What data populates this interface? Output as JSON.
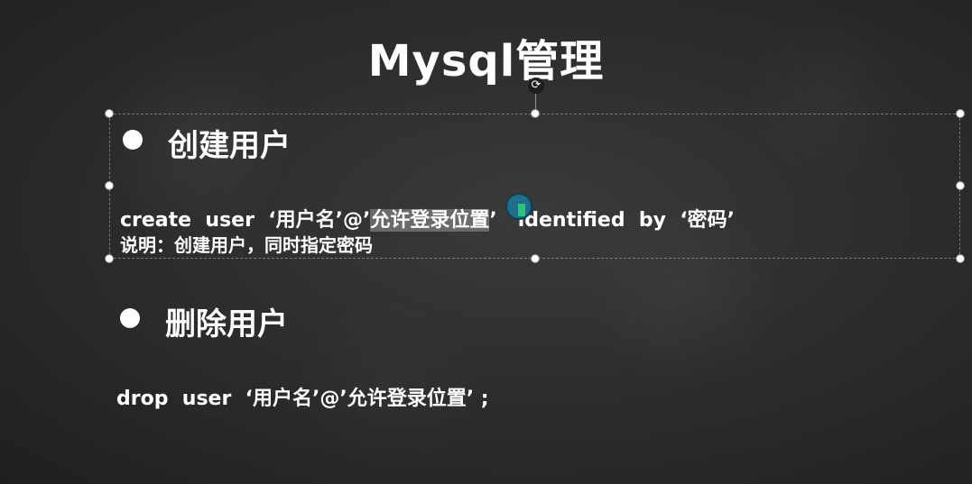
{
  "slide": {
    "title": "Mysql管理",
    "section1": {
      "heading": "创建用户",
      "code_prefix": "create  user  ‘用户名’@’",
      "code_highlight": "允许登录位置",
      "code_suffix": "’   identified  by  ‘密码’",
      "note": "说明：创建用户，同时指定密码"
    },
    "section2": {
      "heading": "删除用户",
      "code": "drop  user  ‘用户名’@’允许登录位置’ ;"
    }
  },
  "icons": {
    "rotate": "rotate-icon",
    "cursor": "mouse-cursor-icon"
  }
}
